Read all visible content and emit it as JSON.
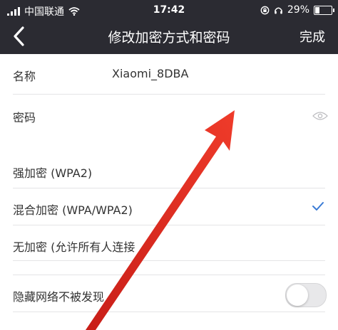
{
  "status_bar": {
    "carrier": "中国联通",
    "time": "17:42",
    "battery": "29%"
  },
  "nav": {
    "title": "修改加密方式和密码",
    "done_label": "完成"
  },
  "fields": {
    "name_label": "名称",
    "name_value": "Xiaomi_8DBA",
    "password_label": "密码"
  },
  "encryption_options": [
    {
      "label": "强加密 (WPA2)",
      "selected": false
    },
    {
      "label": "混合加密 (WPA/WPA2)",
      "selected": true
    },
    {
      "label": "无加密 (允许所有人连接",
      "selected": false
    }
  ],
  "hidden_network": {
    "label": "隐藏网络不被发现",
    "enabled": false
  },
  "colors": {
    "nav_bg": "#2b2b32",
    "check_blue": "#3a7bd5",
    "annotation_arrow": "#e8281f"
  }
}
